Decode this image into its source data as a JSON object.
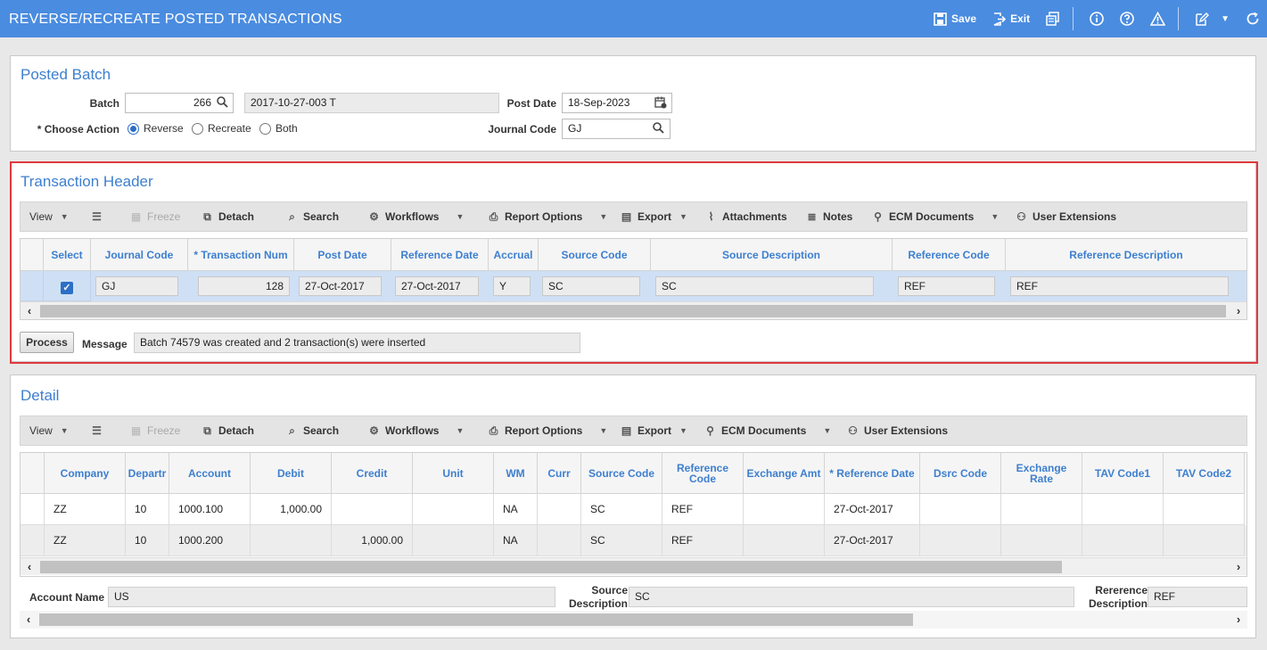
{
  "window": {
    "title": "REVERSE/RECREATE POSTED TRANSACTIONS",
    "save_label": "Save",
    "exit_label": "Exit"
  },
  "icons": {
    "save": "save-icon",
    "exit": "exit-icon",
    "print": "print-icon",
    "info": "info-icon",
    "help": "help-icon",
    "warning": "warning-icon",
    "edit": "edit-icon",
    "refresh": "refresh-icon"
  },
  "posted_batch": {
    "title": "Posted Batch",
    "batch_label": "Batch",
    "batch_value": "266",
    "batch_description": "2017-10-27-003 T",
    "post_date_label": "Post Date",
    "post_date_value": "18-Sep-2023",
    "choose_action_label": "* Choose Action",
    "action_options": [
      "Reverse",
      "Recreate",
      "Both"
    ],
    "selected_action": "Reverse",
    "journal_code_label": "Journal Code",
    "journal_code_value": "GJ"
  },
  "transaction_header": {
    "title": "Transaction Header",
    "toolbar": {
      "view": "View",
      "freeze": "Freeze",
      "detach": "Detach",
      "search": "Search",
      "workflows": "Workflows",
      "report_options": "Report Options",
      "export": "Export",
      "attachments": "Attachments",
      "notes": "Notes",
      "ecm_documents": "ECM Documents",
      "user_extensions": "User Extensions"
    },
    "columns": [
      "Select",
      "Journal Code",
      "* Transaction Num",
      "Post Date",
      "Reference Date",
      "Accrual",
      "Source Code",
      "Source Description",
      "Reference Code",
      "Reference Description"
    ],
    "rows": [
      {
        "selected": true,
        "journal_code": "GJ",
        "transaction_num": "128",
        "post_date": "27-Oct-2017",
        "reference_date": "27-Oct-2017",
        "accrual": "Y",
        "source_code": "SC",
        "source_description": "SC",
        "reference_code": "REF",
        "reference_description": "REF"
      }
    ],
    "process_label": "Process",
    "message_label": "Message",
    "message_value": "Batch 74579 was created and 2 transaction(s) were inserted"
  },
  "detail": {
    "title": "Detail",
    "toolbar": {
      "view": "View",
      "freeze": "Freeze",
      "detach": "Detach",
      "search": "Search",
      "workflows": "Workflows",
      "report_options": "Report Options",
      "export": "Export",
      "ecm_documents": "ECM Documents",
      "user_extensions": "User Extensions"
    },
    "columns": [
      "Company",
      "Departr",
      "Account",
      "Debit",
      "Credit",
      "Unit",
      "WM",
      "Curr",
      "Source Code",
      "Reference Code",
      "Exchange Amt",
      "* Reference Date",
      "Dsrc Code",
      "Exchange Rate",
      "TAV Code1",
      "TAV Code2"
    ],
    "rows": [
      {
        "company": "ZZ",
        "department": "10",
        "account": "1000.100",
        "debit": "1,000.00",
        "credit": "",
        "unit": "",
        "wm": "NA",
        "curr": "",
        "source_code": "SC",
        "reference_code": "REF",
        "exchange_amt": "",
        "reference_date": "27-Oct-2017",
        "dsrc_code": "",
        "exchange_rate": "",
        "tav1": "",
        "tav2": ""
      },
      {
        "company": "ZZ",
        "department": "10",
        "account": "1000.200",
        "debit": "",
        "credit": "1,000.00",
        "unit": "",
        "wm": "NA",
        "curr": "",
        "source_code": "SC",
        "reference_code": "REF",
        "exchange_amt": "",
        "reference_date": "27-Oct-2017",
        "dsrc_code": "",
        "exchange_rate": "",
        "tav1": "",
        "tav2": ""
      }
    ],
    "account_name_label": "Account Name",
    "account_name_value": "US",
    "source_description_label_line1": "Source",
    "source_description_label_line2": "Description",
    "source_description_value": "SC",
    "reference_description_label_line1": "Rererence",
    "reference_description_label_line2": "Description",
    "reference_description_value": "REF"
  }
}
